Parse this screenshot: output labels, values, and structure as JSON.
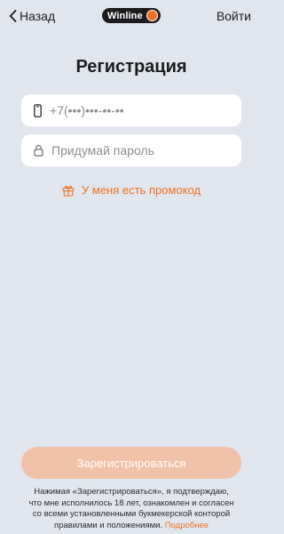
{
  "header": {
    "back_label": "Назад",
    "logo_text": "Winline",
    "login_label": "Войти"
  },
  "title": "Регистрация",
  "phone": {
    "placeholder": "+7(•••)•••-••-••"
  },
  "password": {
    "placeholder": "Придумай пароль"
  },
  "promo": {
    "label": "У меня есть промокод"
  },
  "register_button": {
    "label": "Зарегистрироваться"
  },
  "disclaimer": {
    "text": "Нажимая «Зарегистрироваться», я подтверждаю, что мне исполнилось 18 лет, ознакомлен и согласен со всеми установленными букмекерской конторой правилами и положениями.",
    "more_link": "Подробнее"
  },
  "colors": {
    "accent": "#f26f21",
    "background": "#e1e6ee",
    "button_disabled": "#f0c2a9"
  },
  "icons": {
    "back": "chevron-left-icon",
    "phone": "phone-icon",
    "lock": "lock-icon",
    "gift": "gift-icon"
  }
}
